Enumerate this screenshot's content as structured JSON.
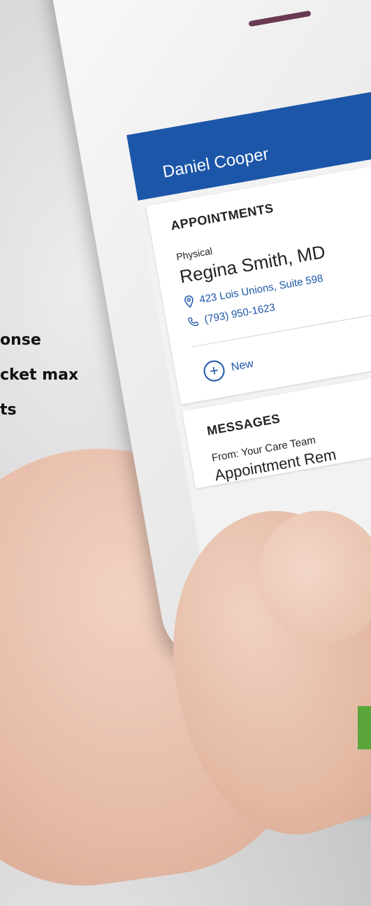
{
  "background_text": [
    "onse",
    "cket max",
    "ts"
  ],
  "app": {
    "user_name": "Daniel Cooper",
    "colors": {
      "header": "#1c56a8",
      "link": "#1c56a8"
    }
  },
  "appointments": {
    "title": "APPOINTMENTS",
    "type": "Physical",
    "doctor": "Regina Smith, MD",
    "address": "423 Lois Unions, Suite 598",
    "phone": "(793) 950-1623",
    "new_label": "New"
  },
  "messages": {
    "title": "MESSAGES",
    "from": "From: Your Care Team",
    "subject": "Appointment Rem"
  }
}
